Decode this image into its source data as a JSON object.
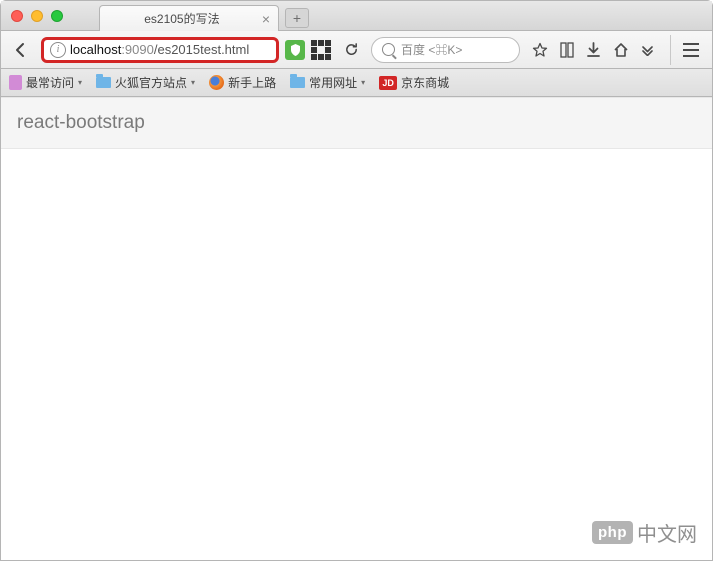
{
  "tab": {
    "title": "es2105的写法"
  },
  "url": {
    "host": "localhost",
    "port": ":9090",
    "path": "/es2015test.html"
  },
  "search": {
    "placeholder": "百度 <⌘K>"
  },
  "bookmarks": {
    "most_visited": "最常访问",
    "firefox_official": "火狐官方站点",
    "getting_started": "新手上路",
    "common_urls": "常用网址",
    "jd_badge": "JD",
    "jd": "京东商城"
  },
  "page": {
    "heading": "react-bootstrap"
  },
  "watermark": {
    "badge": "php",
    "text": "中文网"
  }
}
